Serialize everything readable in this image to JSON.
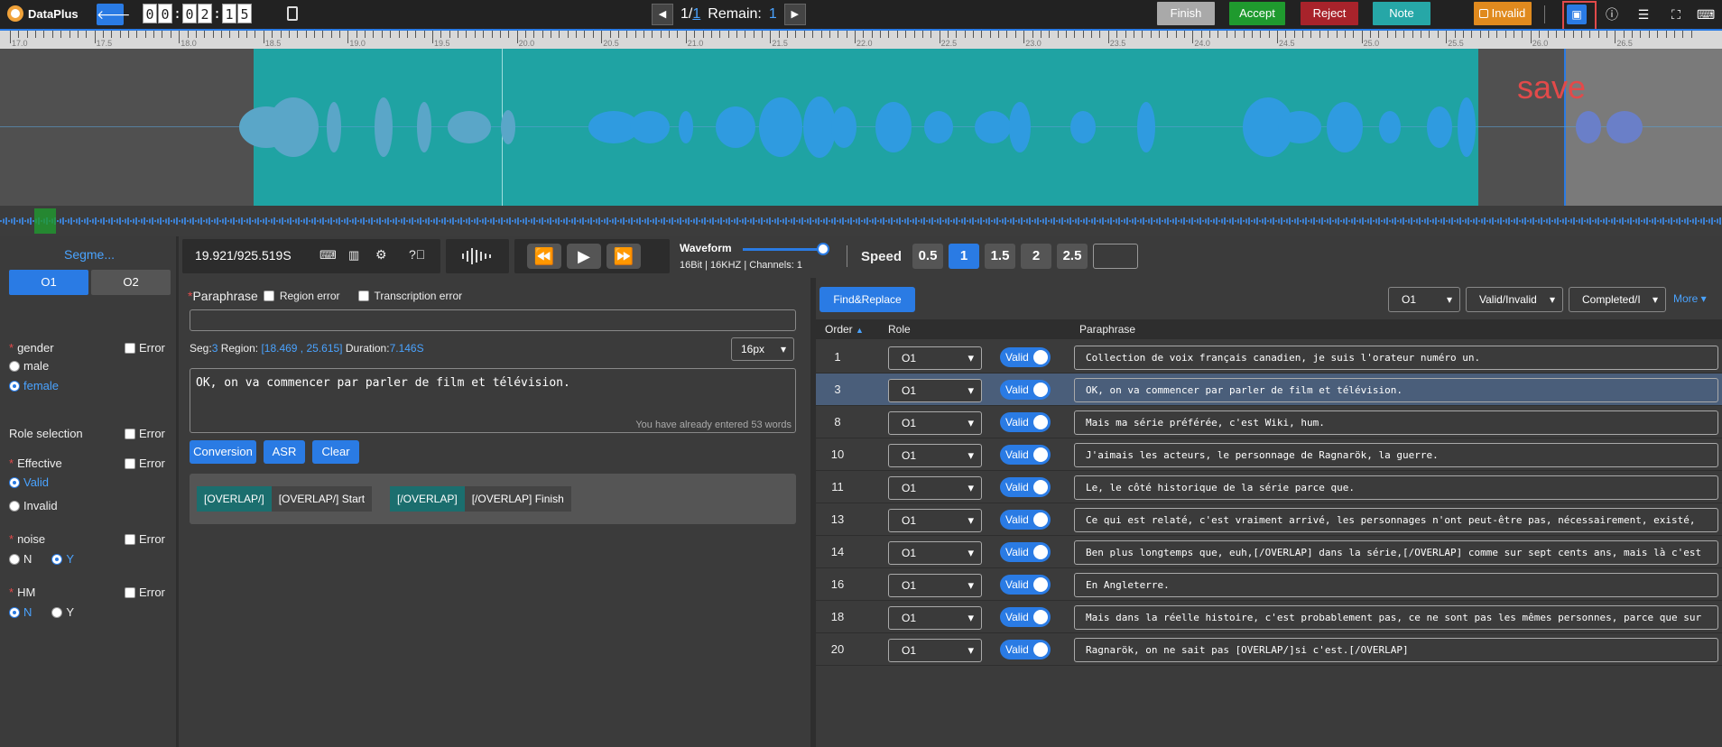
{
  "app": {
    "name": "DataPlus"
  },
  "timer": [
    "0",
    "0",
    "0",
    "2",
    "1",
    "5"
  ],
  "nav": {
    "current": "1",
    "total": "1",
    "remain_label": "Remain:",
    "remain_value": "1"
  },
  "actions": {
    "finish": "Finish",
    "accept": "Accept",
    "reject": "Reject",
    "note": "Note",
    "invalid": "Invalid"
  },
  "annotation": {
    "save_label": "save"
  },
  "ruler": {
    "labels": [
      "17.0",
      "17.5",
      "18.0",
      "18.5",
      "19.0",
      "19.5",
      "20.0",
      "20.5",
      "21.0",
      "21.5",
      "22.0",
      "22.5",
      "23.0",
      "23.5",
      "24.0",
      "24.5",
      "25.0",
      "25.5",
      "26.0",
      "26.5"
    ]
  },
  "left": {
    "title": "Segme...",
    "tabs": [
      "O1",
      "O2"
    ],
    "gender": {
      "label": "gender",
      "options": [
        "male",
        "female"
      ],
      "selected": "female"
    },
    "role_selection": {
      "label": "Role selection"
    },
    "effective": {
      "label": "Effective",
      "options": [
        "Valid",
        "Invalid"
      ],
      "selected": "Valid"
    },
    "noise": {
      "label": "noise",
      "options": [
        "N",
        "Y"
      ],
      "selected": "Y"
    },
    "hm": {
      "label": "HM",
      "options": [
        "N",
        "Y"
      ],
      "selected": "N"
    },
    "error_label": "Error"
  },
  "controls": {
    "time": "19.921/925.519S",
    "waveform_label": "Waveform",
    "audio_info": "16Bit | 16KHZ | Channels: 1",
    "speed_label": "Speed",
    "speeds": [
      "0.5",
      "1",
      "1.5",
      "2",
      "2.5"
    ],
    "speed_selected": "1"
  },
  "editor": {
    "paraphrase_label": "Paraphrase",
    "region_error": "Region error",
    "transcription_error": "Transcription error",
    "seg_label": "Seg:",
    "seg_value": "3",
    "region_label": "Region:",
    "region_value": "[18.469 , 25.615]",
    "duration_label": "Duration:",
    "duration_value": "7.146S",
    "font_size": "16px",
    "text": "OK, on va commencer par parler de film et télévision.",
    "word_count": "You have already entered 53 words",
    "buttons": {
      "conversion": "Conversion",
      "asr": "ASR",
      "clear": "Clear"
    },
    "tags": [
      {
        "tag": "[OVERLAP/]",
        "desc": "[OVERLAP/] Start"
      },
      {
        "tag": "[/OVERLAP]",
        "desc": "[/OVERLAP] Finish"
      }
    ]
  },
  "table": {
    "find_replace": "Find&Replace",
    "filters": [
      "O1",
      "Valid/Invalid",
      "Completed/I"
    ],
    "more": "More",
    "headers": {
      "order": "Order",
      "role": "Role",
      "paraphrase": "Paraphrase"
    },
    "rows": [
      {
        "order": "1",
        "role": "O1",
        "valid": "Valid",
        "text": "Collection de voix français canadien, je suis l'orateur numéro un."
      },
      {
        "order": "3",
        "role": "O1",
        "valid": "Valid",
        "text": "OK, on va commencer par parler de film et télévision."
      },
      {
        "order": "8",
        "role": "O1",
        "valid": "Valid",
        "text": "Mais ma série préférée, c'est Wiki, hum."
      },
      {
        "order": "10",
        "role": "O1",
        "valid": "Valid",
        "text": "J'aimais les acteurs, le personnage de Ragnarök, la guerre."
      },
      {
        "order": "11",
        "role": "O1",
        "valid": "Valid",
        "text": "Le, le côté historique de la série parce que."
      },
      {
        "order": "13",
        "role": "O1",
        "valid": "Valid",
        "text": "Ce qui est relaté, c'est vraiment arrivé, les personnages n'ont peut-être pas, nécessairement, existé,"
      },
      {
        "order": "14",
        "role": "O1",
        "valid": "Valid",
        "text": "Ben plus longtemps que, euh,[/OVERLAP] dans la série,[/OVERLAP] comme sur sept cents ans, mais là c'est"
      },
      {
        "order": "16",
        "role": "O1",
        "valid": "Valid",
        "text": "En Angleterre."
      },
      {
        "order": "18",
        "role": "O1",
        "valid": "Valid",
        "text": "Mais dans la réelle histoire, c'est probablement pas, ce ne sont pas les mêmes personnes, parce que sur"
      },
      {
        "order": "20",
        "role": "O1",
        "valid": "Valid",
        "text": "Ragnarök, on ne sait pas [OVERLAP/]si c'est.[/OVERLAP]"
      }
    ],
    "selected_order": "3"
  },
  "colors": {
    "accent": "#2a7be4",
    "region": "#1fa3a3",
    "finish": "#a9a9a9",
    "accept": "#1f9a2e",
    "reject": "#a8232b",
    "note": "#26a7a7",
    "invalid": "#e08a1e"
  }
}
